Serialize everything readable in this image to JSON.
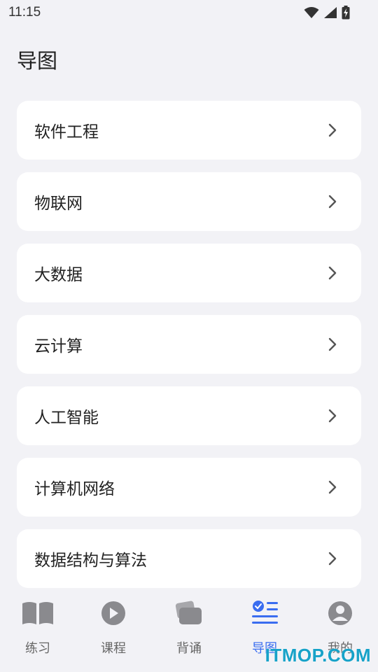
{
  "status_bar": {
    "time": "11:15",
    "icons": [
      "wifi-icon",
      "signal-icon",
      "battery-charging-icon"
    ]
  },
  "page": {
    "title": "导图"
  },
  "topics": [
    {
      "label": "软件工程"
    },
    {
      "label": "物联网"
    },
    {
      "label": "大数据"
    },
    {
      "label": "云计算"
    },
    {
      "label": "人工智能"
    },
    {
      "label": "计算机网络"
    },
    {
      "label": "数据结构与算法"
    }
  ],
  "bottom_nav": {
    "items": [
      {
        "label": "练习",
        "icon": "open-book-icon"
      },
      {
        "label": "课程",
        "icon": "play-circle-icon"
      },
      {
        "label": "背诵",
        "icon": "cards-icon"
      },
      {
        "label": "导图",
        "icon": "mindmap-list-icon",
        "active": true
      },
      {
        "label": "我的",
        "icon": "user-profile-icon"
      }
    ]
  },
  "watermark": "ITMOP.COM",
  "colors": {
    "accent": "#3a6df0",
    "background": "#f2f2f6",
    "card": "#ffffff",
    "watermark": "#17a2c8"
  }
}
